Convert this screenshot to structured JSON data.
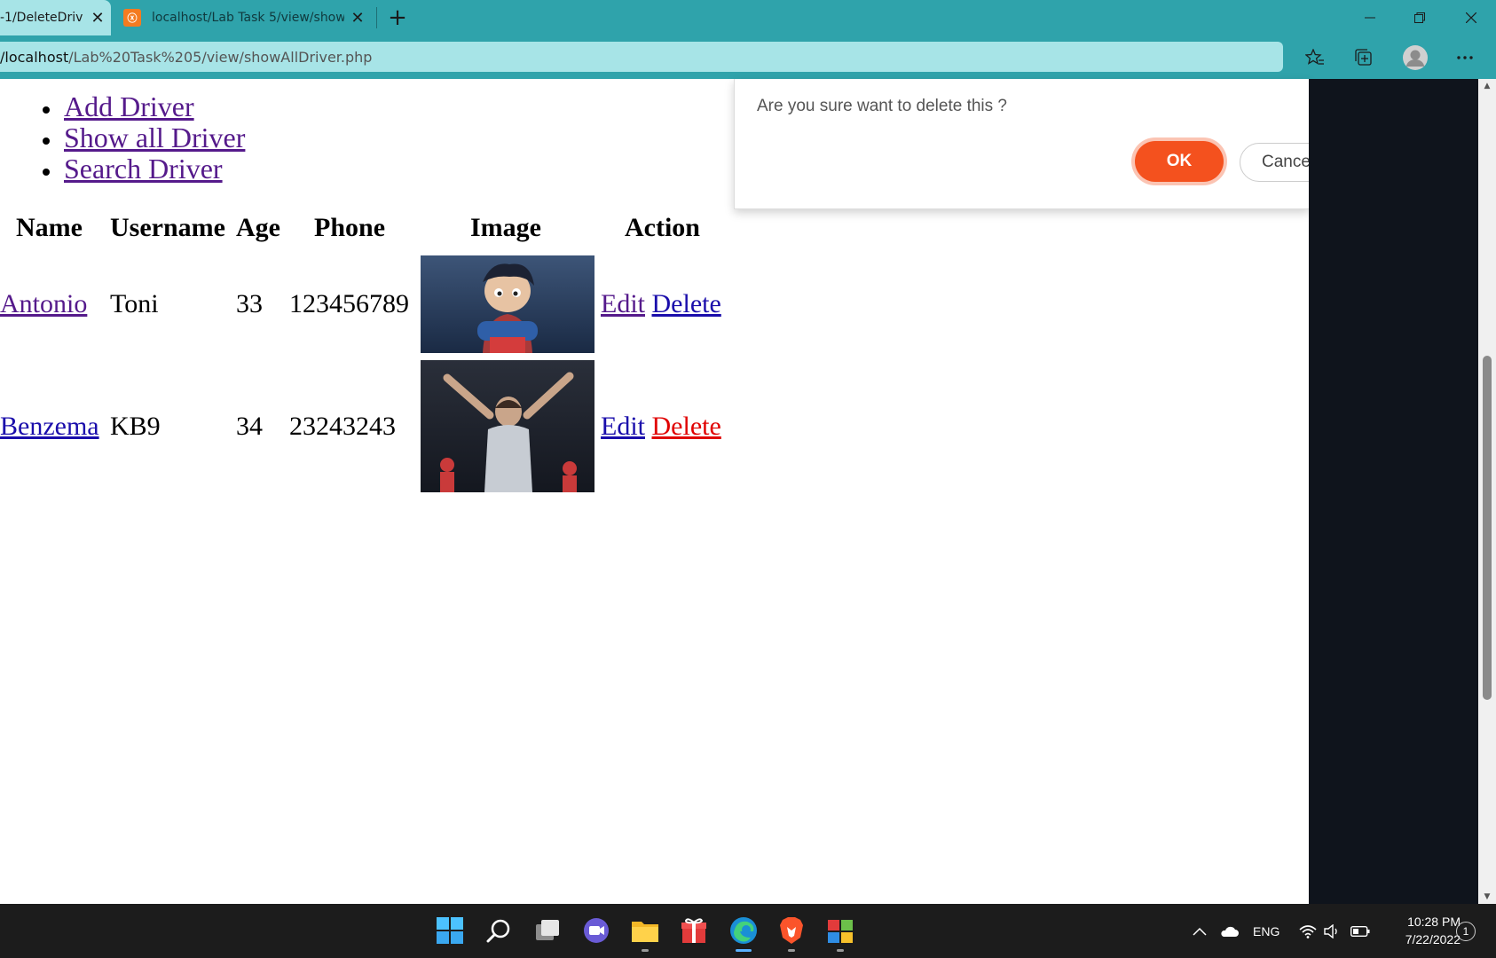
{
  "browser": {
    "tabs": [
      {
        "title": "-1/DeleteDriv",
        "close": "✕"
      },
      {
        "title": "localhost/Lab Task 5/view/showA",
        "close": "✕",
        "favicon": "xampp-icon"
      }
    ],
    "new_tab": "+",
    "window_controls": {
      "minimize": "—",
      "restore": "❐",
      "close": "✕"
    },
    "address": {
      "host": "/localhost",
      "path": "/Lab%20Task%205/view/showAllDriver.php"
    }
  },
  "nav": {
    "items": [
      {
        "label": "Add Driver"
      },
      {
        "label": "Show all Driver"
      },
      {
        "label": "Search Driver"
      }
    ]
  },
  "table": {
    "headers": [
      "Name",
      "Username",
      "Age",
      "Phone",
      "Image",
      "Action"
    ],
    "rows": [
      {
        "name": "Antonio",
        "username": "Toni",
        "age": "33",
        "phone": "123456789",
        "image": "animated-character-photo",
        "edit": "Edit",
        "delete": "Delete"
      },
      {
        "name": "Benzema",
        "username": "KB9",
        "age": "34",
        "phone": "23243243",
        "image": "football-player-photo",
        "edit": "Edit",
        "delete": "Delete"
      }
    ]
  },
  "dialog": {
    "message": "Are you sure want to delete this ?",
    "ok_label": "OK",
    "cancel_label": "Cance"
  },
  "taskbar": {
    "tray": {
      "language": "ENG"
    },
    "clock": {
      "time": "10:28 PM",
      "date": "7/22/2022"
    },
    "notification_count": "1"
  },
  "colors": {
    "chrome": "#2fa3ab",
    "active_tab": "#a7e4e7",
    "ok_button": "#f4511e",
    "visited_link": "#551a8b",
    "link": "#1a0dab",
    "active_link": "#e00000"
  }
}
